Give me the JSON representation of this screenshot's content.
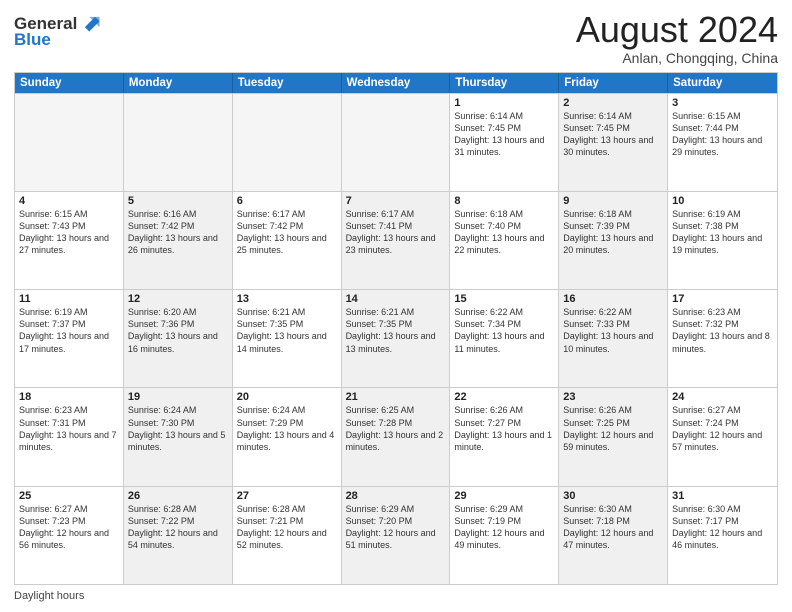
{
  "header": {
    "logo_line1": "General",
    "logo_line2": "Blue",
    "month_title": "August 2024",
    "subtitle": "Anlan, Chongqing, China"
  },
  "days_of_week": [
    "Sunday",
    "Monday",
    "Tuesday",
    "Wednesday",
    "Thursday",
    "Friday",
    "Saturday"
  ],
  "weeks": [
    [
      {
        "day": "",
        "empty": true
      },
      {
        "day": "",
        "empty": true
      },
      {
        "day": "",
        "empty": true
      },
      {
        "day": "",
        "empty": true
      },
      {
        "day": "1",
        "sunrise": "Sunrise: 6:14 AM",
        "sunset": "Sunset: 7:45 PM",
        "daylight": "Daylight: 13 hours and 31 minutes."
      },
      {
        "day": "2",
        "sunrise": "Sunrise: 6:14 AM",
        "sunset": "Sunset: 7:45 PM",
        "daylight": "Daylight: 13 hours and 30 minutes.",
        "shaded": true
      },
      {
        "day": "3",
        "sunrise": "Sunrise: 6:15 AM",
        "sunset": "Sunset: 7:44 PM",
        "daylight": "Daylight: 13 hours and 29 minutes."
      }
    ],
    [
      {
        "day": "4",
        "sunrise": "Sunrise: 6:15 AM",
        "sunset": "Sunset: 7:43 PM",
        "daylight": "Daylight: 13 hours and 27 minutes."
      },
      {
        "day": "5",
        "sunrise": "Sunrise: 6:16 AM",
        "sunset": "Sunset: 7:42 PM",
        "daylight": "Daylight: 13 hours and 26 minutes.",
        "shaded": true
      },
      {
        "day": "6",
        "sunrise": "Sunrise: 6:17 AM",
        "sunset": "Sunset: 7:42 PM",
        "daylight": "Daylight: 13 hours and 25 minutes."
      },
      {
        "day": "7",
        "sunrise": "Sunrise: 6:17 AM",
        "sunset": "Sunset: 7:41 PM",
        "daylight": "Daylight: 13 hours and 23 minutes.",
        "shaded": true
      },
      {
        "day": "8",
        "sunrise": "Sunrise: 6:18 AM",
        "sunset": "Sunset: 7:40 PM",
        "daylight": "Daylight: 13 hours and 22 minutes."
      },
      {
        "day": "9",
        "sunrise": "Sunrise: 6:18 AM",
        "sunset": "Sunset: 7:39 PM",
        "daylight": "Daylight: 13 hours and 20 minutes.",
        "shaded": true
      },
      {
        "day": "10",
        "sunrise": "Sunrise: 6:19 AM",
        "sunset": "Sunset: 7:38 PM",
        "daylight": "Daylight: 13 hours and 19 minutes."
      }
    ],
    [
      {
        "day": "11",
        "sunrise": "Sunrise: 6:19 AM",
        "sunset": "Sunset: 7:37 PM",
        "daylight": "Daylight: 13 hours and 17 minutes."
      },
      {
        "day": "12",
        "sunrise": "Sunrise: 6:20 AM",
        "sunset": "Sunset: 7:36 PM",
        "daylight": "Daylight: 13 hours and 16 minutes.",
        "shaded": true
      },
      {
        "day": "13",
        "sunrise": "Sunrise: 6:21 AM",
        "sunset": "Sunset: 7:35 PM",
        "daylight": "Daylight: 13 hours and 14 minutes."
      },
      {
        "day": "14",
        "sunrise": "Sunrise: 6:21 AM",
        "sunset": "Sunset: 7:35 PM",
        "daylight": "Daylight: 13 hours and 13 minutes.",
        "shaded": true
      },
      {
        "day": "15",
        "sunrise": "Sunrise: 6:22 AM",
        "sunset": "Sunset: 7:34 PM",
        "daylight": "Daylight: 13 hours and 11 minutes."
      },
      {
        "day": "16",
        "sunrise": "Sunrise: 6:22 AM",
        "sunset": "Sunset: 7:33 PM",
        "daylight": "Daylight: 13 hours and 10 minutes.",
        "shaded": true
      },
      {
        "day": "17",
        "sunrise": "Sunrise: 6:23 AM",
        "sunset": "Sunset: 7:32 PM",
        "daylight": "Daylight: 13 hours and 8 minutes."
      }
    ],
    [
      {
        "day": "18",
        "sunrise": "Sunrise: 6:23 AM",
        "sunset": "Sunset: 7:31 PM",
        "daylight": "Daylight: 13 hours and 7 minutes."
      },
      {
        "day": "19",
        "sunrise": "Sunrise: 6:24 AM",
        "sunset": "Sunset: 7:30 PM",
        "daylight": "Daylight: 13 hours and 5 minutes.",
        "shaded": true
      },
      {
        "day": "20",
        "sunrise": "Sunrise: 6:24 AM",
        "sunset": "Sunset: 7:29 PM",
        "daylight": "Daylight: 13 hours and 4 minutes."
      },
      {
        "day": "21",
        "sunrise": "Sunrise: 6:25 AM",
        "sunset": "Sunset: 7:28 PM",
        "daylight": "Daylight: 13 hours and 2 minutes.",
        "shaded": true
      },
      {
        "day": "22",
        "sunrise": "Sunrise: 6:26 AM",
        "sunset": "Sunset: 7:27 PM",
        "daylight": "Daylight: 13 hours and 1 minute."
      },
      {
        "day": "23",
        "sunrise": "Sunrise: 6:26 AM",
        "sunset": "Sunset: 7:25 PM",
        "daylight": "Daylight: 12 hours and 59 minutes.",
        "shaded": true
      },
      {
        "day": "24",
        "sunrise": "Sunrise: 6:27 AM",
        "sunset": "Sunset: 7:24 PM",
        "daylight": "Daylight: 12 hours and 57 minutes."
      }
    ],
    [
      {
        "day": "25",
        "sunrise": "Sunrise: 6:27 AM",
        "sunset": "Sunset: 7:23 PM",
        "daylight": "Daylight: 12 hours and 56 minutes."
      },
      {
        "day": "26",
        "sunrise": "Sunrise: 6:28 AM",
        "sunset": "Sunset: 7:22 PM",
        "daylight": "Daylight: 12 hours and 54 minutes.",
        "shaded": true
      },
      {
        "day": "27",
        "sunrise": "Sunrise: 6:28 AM",
        "sunset": "Sunset: 7:21 PM",
        "daylight": "Daylight: 12 hours and 52 minutes."
      },
      {
        "day": "28",
        "sunrise": "Sunrise: 6:29 AM",
        "sunset": "Sunset: 7:20 PM",
        "daylight": "Daylight: 12 hours and 51 minutes.",
        "shaded": true
      },
      {
        "day": "29",
        "sunrise": "Sunrise: 6:29 AM",
        "sunset": "Sunset: 7:19 PM",
        "daylight": "Daylight: 12 hours and 49 minutes."
      },
      {
        "day": "30",
        "sunrise": "Sunrise: 6:30 AM",
        "sunset": "Sunset: 7:18 PM",
        "daylight": "Daylight: 12 hours and 47 minutes.",
        "shaded": true
      },
      {
        "day": "31",
        "sunrise": "Sunrise: 6:30 AM",
        "sunset": "Sunset: 7:17 PM",
        "daylight": "Daylight: 12 hours and 46 minutes."
      }
    ]
  ],
  "footer": {
    "daylight_label": "Daylight hours"
  }
}
